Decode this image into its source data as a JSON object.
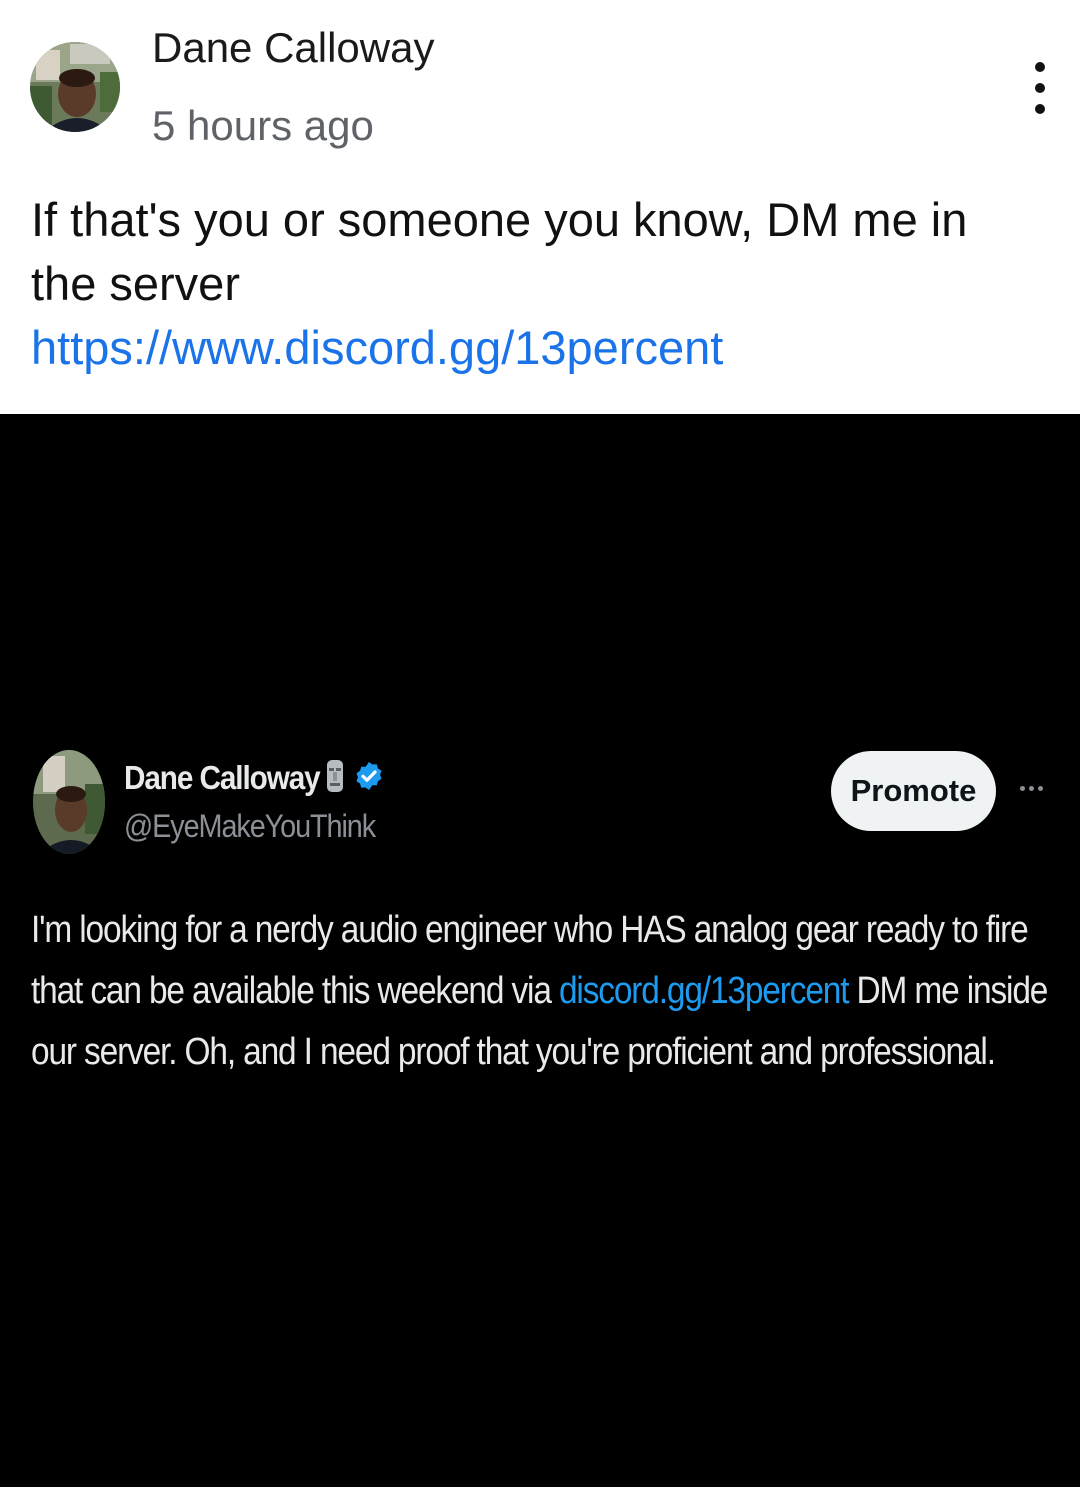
{
  "post": {
    "author": "Dane Calloway",
    "timestamp": "5 hours ago",
    "body": "If that's you or someone you know, DM me in the server",
    "link": "https://www.discord.gg/13percent",
    "menu_icon": "more-vertical-icon"
  },
  "embedded_tweet": {
    "display_name": "Dane Calloway",
    "handle": "@EyeMakeYouThink",
    "verified": true,
    "verified_color": "#1d9bf0",
    "promote_label": "Promote",
    "text_before_link": "I'm looking for a nerdy audio engineer who HAS analog gear ready to fire that can be available this weekend via ",
    "link": "discord.gg/13percent",
    "text_after_link": " DM me inside our server. Oh, and I need proof that you're proficient and professional."
  },
  "colors": {
    "link": "#1a73e8",
    "tweet_link": "#1d9bf0",
    "tweet_background": "#000000"
  }
}
